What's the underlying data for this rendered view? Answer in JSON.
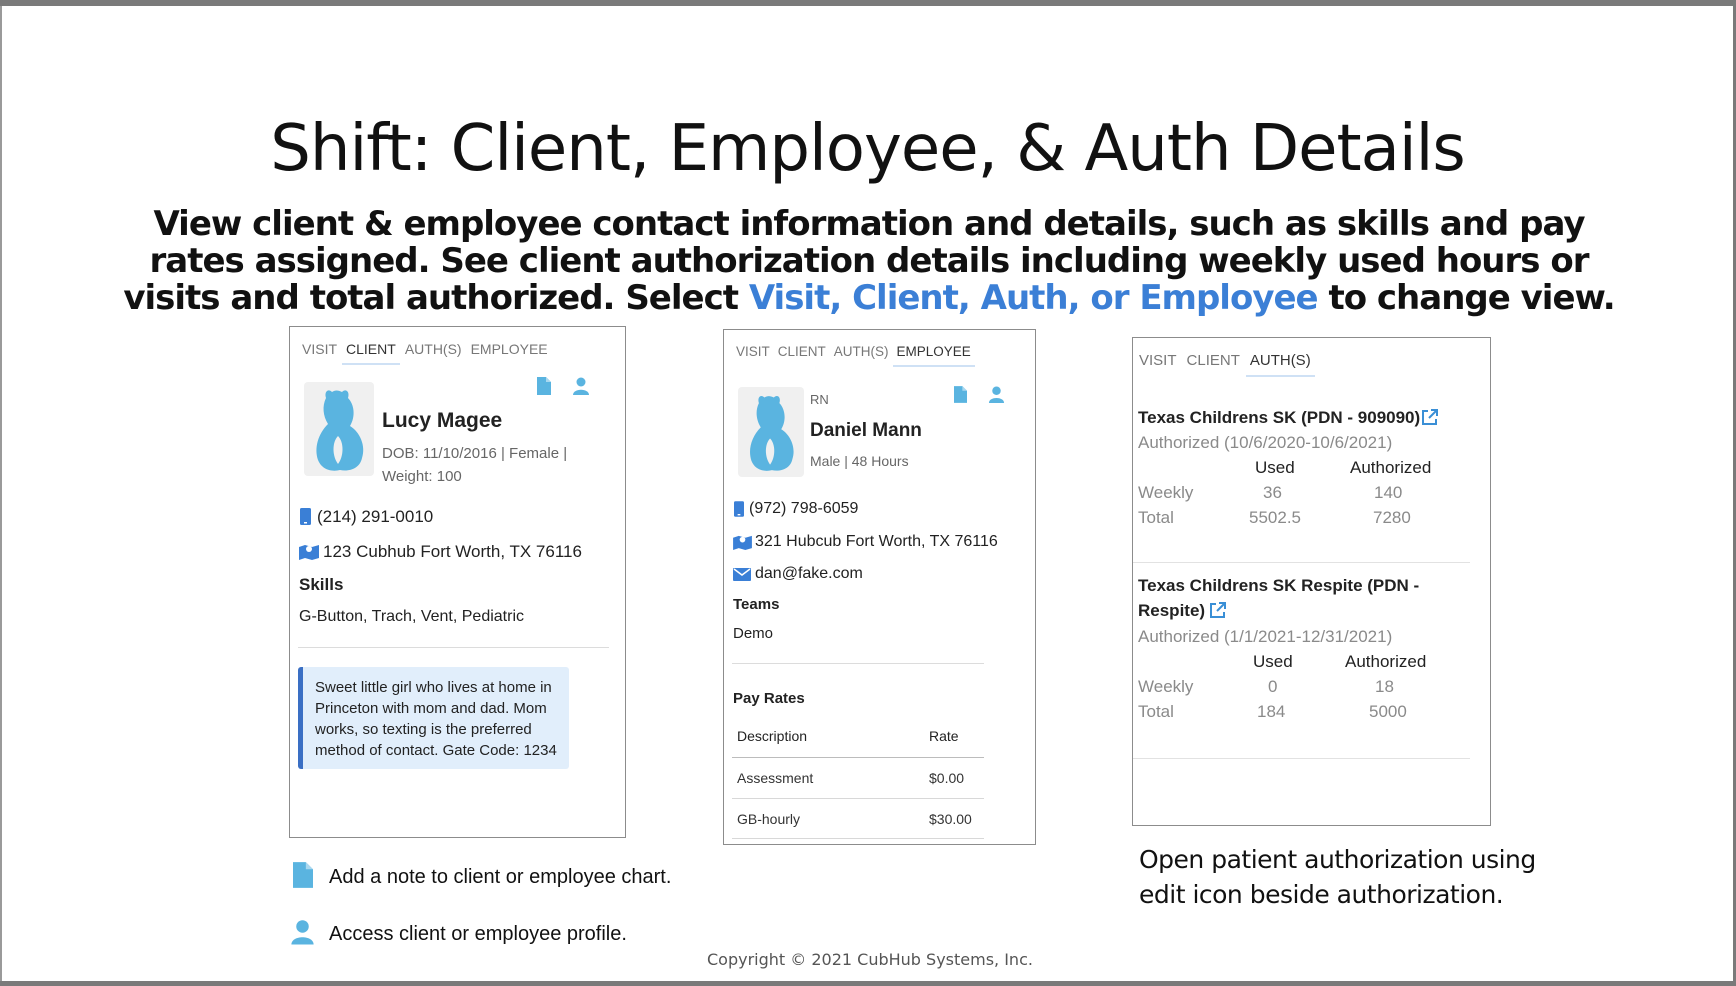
{
  "slide": {
    "title": "Shift: Client, Employee, & Auth Details",
    "subtitle_part1": "View client & employee contact information and details, such as skills and pay rates assigned. See client authorization details including weekly used hours or visits and total authorized. Select ",
    "subtitle_highlight": "Visit, Client, Auth, or Employee",
    "subtitle_part2": " to change view.",
    "highlight_color": "#3b7fd6",
    "copyright": "Copyright © 2021 CubHub Systems, Inc."
  },
  "client_panel": {
    "tabs": [
      "VISIT",
      "CLIENT",
      "AUTH(S)",
      "EMPLOYEE"
    ],
    "active_tab": "CLIENT",
    "name": "Lucy Magee",
    "details_line1": "DOB: 11/10/2016 | Female |",
    "details_line2": "Weight: 100",
    "phone": "(214) 291-0010",
    "address": "123 Cubhub Fort Worth, TX 76116",
    "skills_label": "Skills",
    "skills": "G-Button, Trach, Vent, Pediatric",
    "note_lines": [
      "Sweet little girl who lives at home in",
      "Princeton with mom and dad. Mom",
      "works, so texting is the preferred",
      "method of contact. Gate Code: 1234"
    ],
    "icons": [
      "note-icon",
      "profile-icon",
      "phone-icon",
      "map-icon"
    ]
  },
  "employee_panel": {
    "tabs": [
      "VISIT",
      "CLIENT",
      "AUTH(S)",
      "EMPLOYEE"
    ],
    "active_tab": "EMPLOYEE",
    "role": "RN",
    "name": "Daniel Mann",
    "details": "Male | 48 Hours",
    "phone": "(972) 798-6059",
    "address": "321 Hubcub Fort Worth, TX 76116",
    "email": "dan@fake.com",
    "teams_label": "Teams",
    "teams": "Demo",
    "pay_rates_label": "Pay Rates",
    "columns": [
      "Description",
      "Rate"
    ],
    "rows": [
      {
        "description": "Assessment",
        "rate": "$0.00"
      },
      {
        "description": "GB-hourly",
        "rate": "$30.00"
      }
    ]
  },
  "auth_panel": {
    "tabs": [
      "VISIT",
      "CLIENT",
      "AUTH(S)"
    ],
    "active_tab": "AUTH(S)",
    "auths": [
      {
        "title_line1": "Texas Childrens SK (PDN - 909090)",
        "title_line2": "",
        "period": "Authorized (10/6/2020-10/6/2021)",
        "col_used": "Used",
        "col_authorized": "Authorized",
        "weekly_label": "Weekly",
        "weekly_used": "36",
        "weekly_authorized": "140",
        "total_label": "Total",
        "total_used": "5502.5",
        "total_authorized": "7280"
      },
      {
        "title_line1": "Texas Childrens SK Respite (PDN -",
        "title_line2": "Respite)",
        "period": "Authorized (1/1/2021-12/31/2021)",
        "col_used": "Used",
        "col_authorized": "Authorized",
        "weekly_label": "Weekly",
        "weekly_used": "0",
        "weekly_authorized": "18",
        "total_label": "Total",
        "total_used": "184",
        "total_authorized": "5000"
      }
    ]
  },
  "legend": {
    "note_text": "Add a note to client or employee chart.",
    "profile_text": "Access client or employee profile.",
    "auth_caption_line1": "Open patient authorization using",
    "auth_caption_line2": "edit icon beside authorization."
  },
  "colors": {
    "icon_blue": "#5ab4e0",
    "link_blue": "#3a8fd6",
    "note_border": "#3a6fc4",
    "note_bg": "#e1eefb"
  }
}
